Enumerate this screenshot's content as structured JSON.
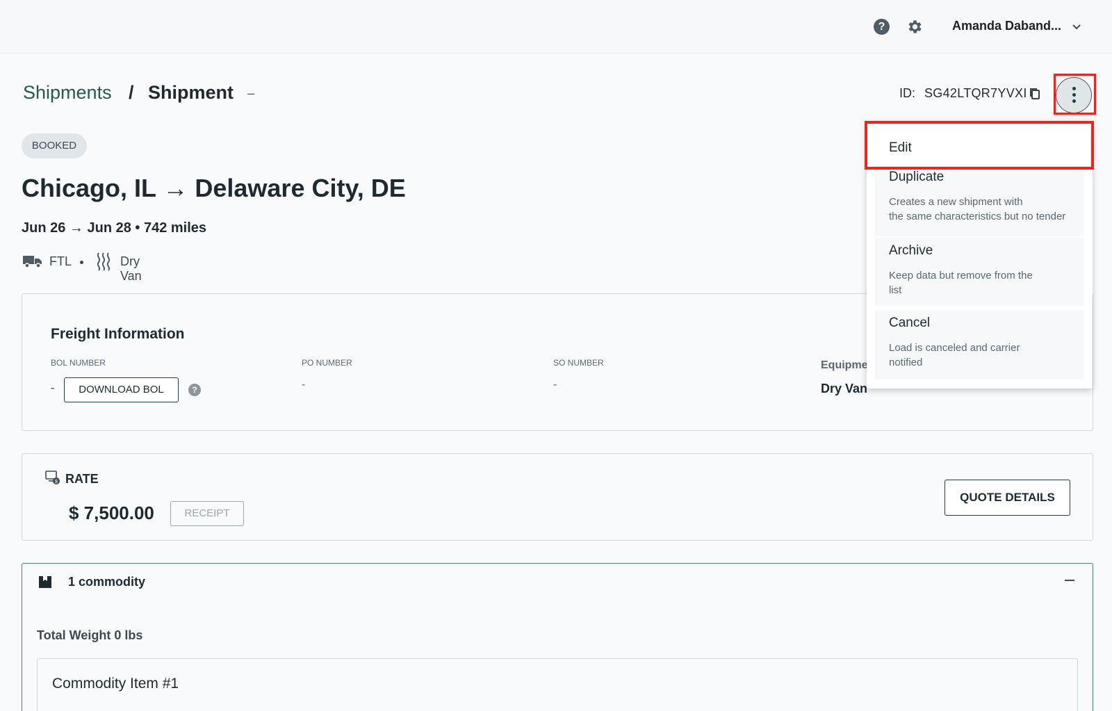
{
  "topbar": {
    "user_name": "Amanda Daband...",
    "icons": [
      "help-icon",
      "gear-icon",
      "chevron-down-icon"
    ]
  },
  "breadcrumb": {
    "link": "Shipments",
    "separator": "/",
    "current": "Shipment",
    "suffix": "–"
  },
  "shipment": {
    "id_label": "ID:",
    "id_value": "SG42LTQR7YVXI",
    "status": "BOOKED",
    "route": "Chicago, IL → Delaware City, DE",
    "dates": "Jun 26  →  Jun 28   •   742  miles",
    "mode": "FTL",
    "equipment": "Dry Van"
  },
  "freight": {
    "title": "Freight Information",
    "bol_label": "BOL NUMBER",
    "bol_value": "-",
    "download_bol": "DOWNLOAD BOL",
    "po_label": "PO NUMBER",
    "po_value": "-",
    "so_label": "SO NUMBER",
    "so_value": "-",
    "equipment_label": "Equipme",
    "equipment_value": "Dry Van"
  },
  "rate": {
    "label": "RATE",
    "amount": "$ 7,500.00",
    "receipt": "RECEIPT",
    "quote_details": "QUOTE DETAILS"
  },
  "commodity": {
    "count": "1 commodity",
    "total_weight": "Total Weight 0 lbs",
    "item_title": "Commodity Item #1"
  },
  "menu": {
    "items": [
      {
        "title": "Edit",
        "desc": ""
      },
      {
        "title": "Duplicate",
        "desc_line1": "Creates a new shipment with",
        "desc_line2": "the same characteristics but no tender"
      },
      {
        "title": "Archive",
        "desc_line1": "Keep data but remove from the",
        "desc_line2": "list"
      },
      {
        "title": "Cancel",
        "desc_line1": "Load is canceled and carrier",
        "desc_line2": "notified"
      }
    ]
  },
  "colors": {
    "accent": "#1d5c4f",
    "highlight": "#e8261e",
    "text": "#1f2a30"
  }
}
